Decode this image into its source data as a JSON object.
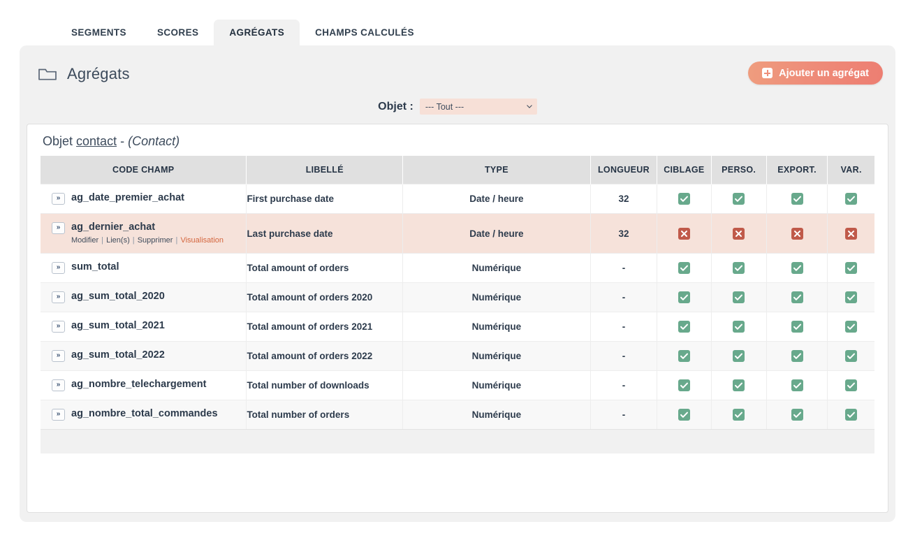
{
  "tabs": [
    {
      "label": "SEGMENTS",
      "active": false
    },
    {
      "label": "SCORES",
      "active": false
    },
    {
      "label": "AGRÉGATS",
      "active": true
    },
    {
      "label": "CHAMPS CALCULÉS",
      "active": false
    }
  ],
  "header": {
    "title": "Agrégats",
    "folder_icon": "folder-icon",
    "add_button": {
      "label": "Ajouter un agrégat",
      "icon": "plus-square-icon"
    }
  },
  "filter": {
    "label": "Objet :",
    "selected": "--- Tout ---",
    "options": [
      "--- Tout ---"
    ],
    "chevron_icon": "chevron-down-icon"
  },
  "panel": {
    "object_heading_prefix": "Objet ",
    "object_name": "contact",
    "object_heading_sep": " - ",
    "object_label": "(Contact)"
  },
  "table": {
    "columns": [
      "CODE CHAMP",
      "LIBELLÉ",
      "TYPE",
      "LONGUEUR",
      "CIBLAGE",
      "PERSO.",
      "EXPORT.",
      "VAR."
    ],
    "row_actions": {
      "modifier": "Modifier",
      "liens": "Lien(s)",
      "supprimer": "Supprimer",
      "visualisation": "Visualisation",
      "separator": "|"
    },
    "rows": [
      {
        "code": "ag_date_premier_achat",
        "libelle": "First purchase date",
        "type": "Date / heure",
        "longueur": "32",
        "ciblage": true,
        "perso": true,
        "export": true,
        "var": true,
        "hovered": false
      },
      {
        "code": "ag_dernier_achat",
        "libelle": "Last purchase date",
        "type": "Date / heure",
        "longueur": "32",
        "ciblage": false,
        "perso": false,
        "export": false,
        "var": false,
        "hovered": true
      },
      {
        "code": "sum_total",
        "libelle": "Total amount of orders",
        "type": "Numérique",
        "longueur": "-",
        "ciblage": true,
        "perso": true,
        "export": true,
        "var": true,
        "hovered": false
      },
      {
        "code": "ag_sum_total_2020",
        "libelle": "Total amount of orders 2020",
        "type": "Numérique",
        "longueur": "-",
        "ciblage": true,
        "perso": true,
        "export": true,
        "var": true,
        "hovered": false
      },
      {
        "code": "ag_sum_total_2021",
        "libelle": "Total amount of orders 2021",
        "type": "Numérique",
        "longueur": "-",
        "ciblage": true,
        "perso": true,
        "export": true,
        "var": true,
        "hovered": false
      },
      {
        "code": "ag_sum_total_2022",
        "libelle": "Total amount of orders 2022",
        "type": "Numérique",
        "longueur": "-",
        "ciblage": true,
        "perso": true,
        "export": true,
        "var": true,
        "hovered": false
      },
      {
        "code": "ag_nombre_telechargement",
        "libelle": "Total number of downloads",
        "type": "Numérique",
        "longueur": "-",
        "ciblage": true,
        "perso": true,
        "export": true,
        "var": true,
        "hovered": false
      },
      {
        "code": "ag_nombre_total_commandes",
        "libelle": "Total number of orders",
        "type": "Numérique",
        "longueur": "-",
        "ciblage": true,
        "perso": true,
        "export": true,
        "var": true,
        "hovered": false
      }
    ]
  },
  "colors": {
    "accent_button_from": "#ef9d7e",
    "accent_button_to": "#ed7e72",
    "hover_row": "#f6e2da",
    "check_green": "#68a98c",
    "cross_red": "#c05a4a",
    "select_bg": "#f7e0d7",
    "viz_link": "#d4663e",
    "header_bg": "#e0e0e0",
    "card_bg": "#f1f1f1"
  },
  "icons": {
    "row_expand": "»"
  }
}
